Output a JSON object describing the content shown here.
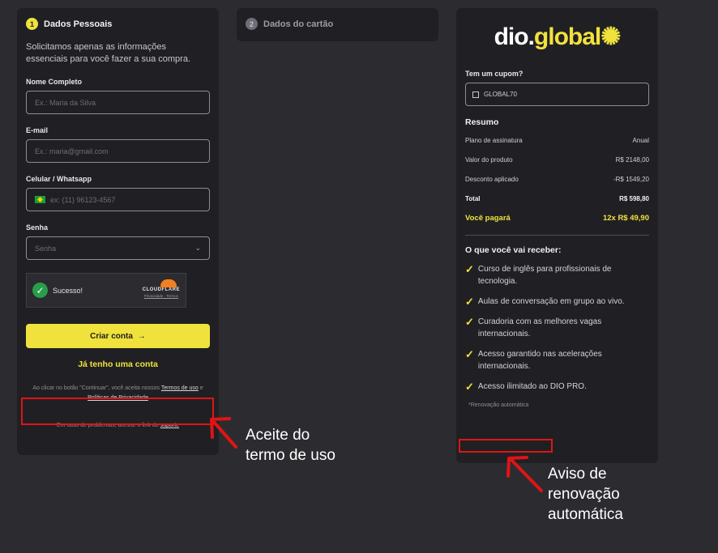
{
  "step1": {
    "number": "1",
    "title": "Dados Pessoais",
    "intro": "Solicitamos apenas as informações essenciais para você fazer a sua compra.",
    "name_label": "Nome Completo",
    "name_placeholder": "Ex.: Maria da Silva",
    "email_label": "E-mail",
    "email_placeholder": "Ex.: maria@gmail.com",
    "phone_label": "Celular / Whatsapp",
    "phone_placeholder": "ex: (11) 96123-4567",
    "password_label": "Senha",
    "password_placeholder": "Senha",
    "captcha_status": "Sucesso!",
    "captcha_brand": "CLOUDFLARE",
    "captcha_links": "Privacidade · Termos",
    "submit_label": "Criar conta",
    "submit_arrow": "→",
    "login_link": "Já tenho uma conta",
    "terms_prefix": "Ao clicar no botão \"Continuar\", você aceita nossos",
    "terms_link": "Termos de uso",
    "terms_and": "e",
    "privacy_link": "Políticas de Privacidade",
    "support_prefix": "Em caso de problemas, acesse o link do",
    "support_link": "suporte"
  },
  "step2": {
    "number": "2",
    "title": "Dados do cartão"
  },
  "summary": {
    "logo_white": "dio.",
    "logo_yellow": "global",
    "coupon_label": "Tem um cupom?",
    "coupon_value": "GLOBAL70",
    "title": "Resumo",
    "rows": [
      {
        "label": "Plano de assinatura",
        "value": "Anual"
      },
      {
        "label": "Valor do produto",
        "value": "R$ 2148,00"
      },
      {
        "label": "Desconto aplicado",
        "value": "-R$ 1549,20"
      }
    ],
    "total_label": "Total",
    "total_value": "R$ 598,80",
    "pay_label": "Você pagará",
    "pay_value": "12x R$ 49,90",
    "benefits_title": "O que você vai receber:",
    "benefits": [
      "Curso de inglês para profissionais de tecnologia.",
      "Aulas de conversação em grupo ao vivo.",
      "Curadoria com as melhores vagas internacionais.",
      "Acesso garantido nas acelerações internacionais.",
      "Acesso ilimitado ao DIO PRO."
    ],
    "renewal_note": "*Renovação automática"
  },
  "annotations": {
    "terms_note": [
      "Aceite do",
      "termo de uso"
    ],
    "renewal_note": [
      "Aviso de",
      "renovação",
      "automática"
    ],
    "highlight_color": "#e01414"
  }
}
